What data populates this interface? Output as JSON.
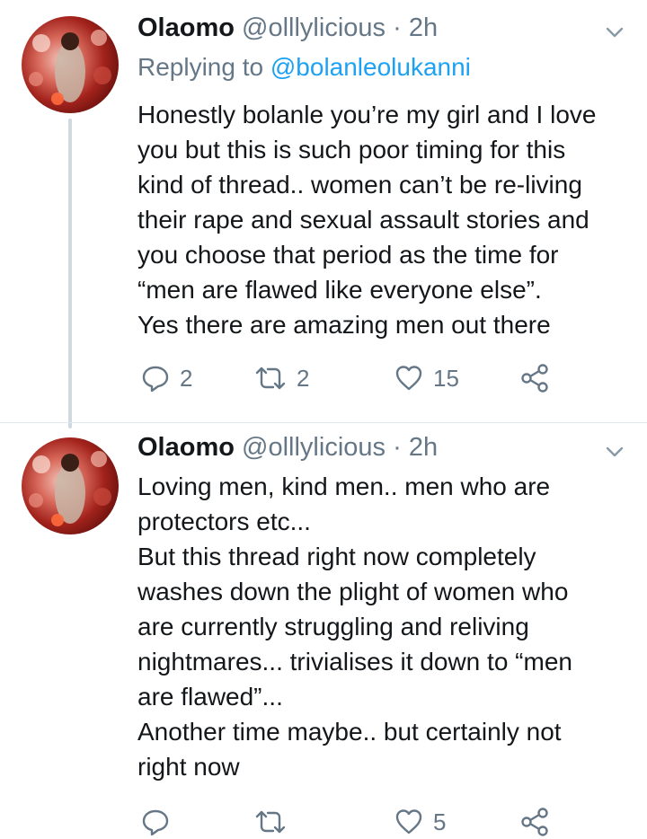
{
  "tweets": [
    {
      "display_name": "Olaomo",
      "handle": "@olllylicious",
      "separator": "·",
      "time": "2h",
      "replying_label": "Replying to",
      "replying_to": "@bolanleolukanni",
      "lines": [
        "Honestly bolanle you’re my girl and I love",
        "you but this is such poor timing for this",
        "kind of thread.. women can’t be re-living",
        "their rape and sexual assault stories and",
        "you choose that period as the time for",
        "“men are flawed like everyone else”.",
        "Yes there are amazing men out there"
      ],
      "reply_count": "2",
      "retweet_count": "2",
      "like_count": "15"
    },
    {
      "display_name": "Olaomo",
      "handle": "@olllylicious",
      "separator": "·",
      "time": "2h",
      "lines": [
        "Loving men, kind men.. men who are",
        "protectors etc...",
        "But this thread right now completely",
        "washes down the plight of women who",
        "are currently struggling and reliving",
        "nightmares... trivialises it down to “men",
        "are flawed”...",
        "Another time maybe.. but certainly not",
        "right now"
      ],
      "like_count": "5"
    }
  ],
  "icons": {
    "reply": "reply-icon",
    "retweet": "retweet-icon",
    "like": "heart-icon",
    "share": "share-icon",
    "menu": "chevron-down-icon"
  },
  "colors": {
    "text": "#14171a",
    "secondary": "#657786",
    "link": "#1da1f2",
    "thread_line": "#cfd9de"
  }
}
